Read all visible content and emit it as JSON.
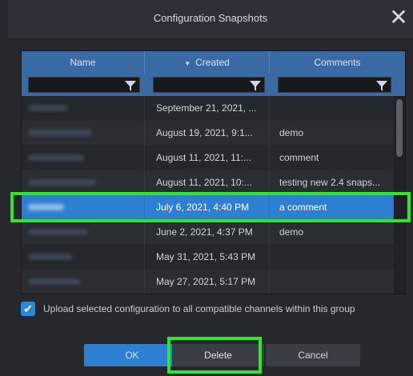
{
  "dialog": {
    "title": "Configuration Snapshots",
    "close_icon": "close-icon"
  },
  "table": {
    "columns": [
      {
        "label": "Name",
        "sortable": true
      },
      {
        "label": "Created",
        "sorted": "descending"
      },
      {
        "label": "Comments"
      }
    ],
    "filter_icon": "funnel-filter-icon",
    "sort_icon": "chevron-down-icon",
    "rows": [
      {
        "name": "████",
        "created": "September 21, 2021, ...",
        "comments": "",
        "selected": false
      },
      {
        "name": "████",
        "created": "August 19, 2021, 9:1...",
        "comments": "demo",
        "selected": false
      },
      {
        "name": "████",
        "created": "August 11, 2021, 11:...",
        "comments": "comment",
        "selected": false
      },
      {
        "name": "████",
        "created": "August 11, 2021, 10:...",
        "comments": "testing new 2.4 snaps...",
        "selected": false
      },
      {
        "name": "████",
        "created": "July 6, 2021, 4:40 PM",
        "comments": "a comment",
        "selected": true
      },
      {
        "name": "████",
        "created": "June 2, 2021, 4:37 PM",
        "comments": "demo",
        "selected": false
      },
      {
        "name": "████",
        "created": "May 31, 2021, 5:43 PM",
        "comments": "",
        "selected": false
      },
      {
        "name": "████",
        "created": "May 27, 2021, 5:17 PM",
        "comments": "",
        "selected": false
      }
    ]
  },
  "upload_option": {
    "checked": true,
    "label": "Upload selected configuration to all compatible channels within this group"
  },
  "buttons": {
    "ok": "OK",
    "delete": "Delete",
    "cancel": "Cancel"
  },
  "colors": {
    "accent": "#2f7fd0",
    "header": "#3a6aa3",
    "highlight": "#2de62d",
    "background": "#26282d"
  }
}
